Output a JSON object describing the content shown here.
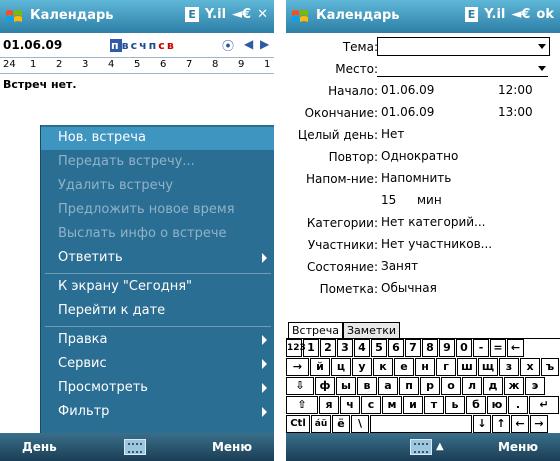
{
  "left": {
    "title": "Календарь",
    "status_e": "E",
    "status_signal": "Y.il",
    "status_volume": "◄€",
    "status_close": "✕",
    "date": "01.06.09",
    "weekdays": [
      "п",
      "в",
      "с",
      "ч",
      "п",
      "с",
      "в"
    ],
    "hours": [
      "24",
      "1",
      "2",
      "3",
      "4",
      "5",
      "6",
      "7",
      "8",
      "9",
      "1"
    ],
    "no_appointments": "Встреч нет.",
    "menu": [
      {
        "label": "Нов. встреча",
        "state": "selected"
      },
      {
        "label": "Передать встречу...",
        "state": "disabled"
      },
      {
        "label": "Удалить встречу",
        "state": "disabled"
      },
      {
        "label": "Предложить новое время",
        "state": "disabled"
      },
      {
        "label": "Выслать инфо о встрече",
        "state": "disabled"
      },
      {
        "label": "Ответить",
        "state": "submenu"
      },
      {
        "label": "К экрану \"Сегодня\"",
        "state": "normal"
      },
      {
        "label": "Перейти к дате",
        "state": "normal"
      },
      {
        "label": "Правка",
        "state": "submenu"
      },
      {
        "label": "Сервис",
        "state": "submenu"
      },
      {
        "label": "Просмотреть",
        "state": "submenu"
      },
      {
        "label": "Фильтр",
        "state": "submenu"
      }
    ],
    "softkey_left": "День",
    "softkey_right": "Меню"
  },
  "right": {
    "title": "Календарь",
    "status_e": "E",
    "status_signal": "Y.il",
    "status_volume": "◄€",
    "status_ok": "ok",
    "fields": {
      "subject_label": "Тема:",
      "location_label": "Место:",
      "start_label": "Начало:",
      "start_date": "01.06.09",
      "start_time": "12:00",
      "end_label": "Окончание:",
      "end_date": "01.06.09",
      "end_time": "13:00",
      "allday_label": "Целый день:",
      "allday_value": "Нет",
      "repeat_label": "Повтор:",
      "repeat_value": "Однократно",
      "reminder_label": "Напом-ние:",
      "reminder_value": "Напомнить",
      "reminder_amount": "15",
      "reminder_unit": "мин",
      "categories_label": "Категории:",
      "categories_value": "Нет категорий...",
      "attendees_label": "Участники:",
      "attendees_value": "Нет участников...",
      "status_label": "Состояние:",
      "status_value": "Занят",
      "note_label": "Пометка:",
      "note_value": "Обычная"
    },
    "tabs": [
      "Встреча",
      "Заметки"
    ],
    "keyboard": [
      [
        "123",
        "1",
        "2",
        "3",
        "4",
        "5",
        "6",
        "7",
        "8",
        "9",
        "0",
        "-",
        "=",
        "←"
      ],
      [
        "→",
        "й",
        "ц",
        "у",
        "к",
        "е",
        "н",
        "г",
        "ш",
        "щ",
        "з",
        "х",
        "ъ"
      ],
      [
        "⇩",
        "ф",
        "ы",
        "в",
        "а",
        "п",
        "р",
        "о",
        "л",
        "д",
        "ж",
        "э"
      ],
      [
        "⇧",
        "я",
        "ч",
        "с",
        "м",
        "и",
        "т",
        "ь",
        "б",
        "ю",
        ".",
        "↵"
      ],
      [
        "Ctl",
        "áü",
        "ё",
        "\\",
        " ",
        "↓",
        "↑",
        "←",
        "→"
      ]
    ],
    "softkey_up": "▲",
    "softkey_right": "Меню"
  },
  "colors": {
    "titlebar": "#2d7fa6",
    "menu_bg": "#2b6e93",
    "menu_selected": "#3e95bf",
    "softbar": "#1b3e55"
  }
}
